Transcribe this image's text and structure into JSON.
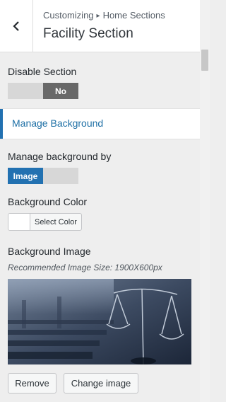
{
  "header": {
    "breadcrumb_root": "Customizing",
    "breadcrumb_separator": "▸",
    "breadcrumb_current": "Home Sections",
    "title": "Facility Section"
  },
  "disable_section": {
    "label": "Disable Section",
    "value": "No"
  },
  "manage_background_link": {
    "label": "Manage Background"
  },
  "manage_by": {
    "label": "Manage background by",
    "value": "Image"
  },
  "background_color": {
    "label": "Background Color",
    "button": "Select Color",
    "value": "#ffffff"
  },
  "background_image": {
    "label": "Background Image",
    "hint": "Recommended Image Size: 1900X600px",
    "image_icon": "scales-of-justice-photo",
    "remove_button": "Remove",
    "change_button": "Change image"
  },
  "colors": {
    "accent": "#2271b1",
    "link": "#1d6fa5",
    "toggle_dark": "#686868"
  }
}
